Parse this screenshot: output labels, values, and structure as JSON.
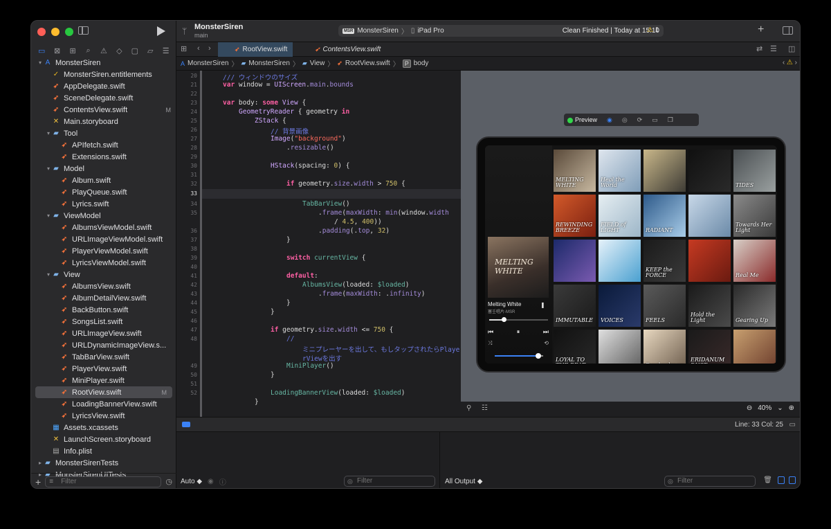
{
  "window": {
    "project_name": "MonsterSiren",
    "branch": "main"
  },
  "toolbar": {
    "scheme": "MonsterSiren",
    "device": "iPad Pro",
    "status": "Clean Finished | Today at 15:10",
    "warning_count": "1",
    "scheme_icon_text": "MSR"
  },
  "sidebar": {
    "items": [
      {
        "label": "MonsterSiren",
        "icon": "project-icon",
        "indent": 0,
        "disclosure": "open"
      },
      {
        "label": "MonsterSiren.entitlements",
        "icon": "entitlements-icon",
        "indent": 1
      },
      {
        "label": "AppDelegate.swift",
        "icon": "swift-icon",
        "indent": 1
      },
      {
        "label": "SceneDelegate.swift",
        "icon": "swift-icon",
        "indent": 1
      },
      {
        "label": "ContentsView.swift",
        "icon": "swift-icon",
        "indent": 1,
        "badge": "M"
      },
      {
        "label": "Main.storyboard",
        "icon": "storyboard-icon",
        "indent": 1
      },
      {
        "label": "Tool",
        "icon": "folder-icon",
        "indent": 1,
        "disclosure": "open"
      },
      {
        "label": "APIfetch.swift",
        "icon": "swift-icon",
        "indent": 2
      },
      {
        "label": "Extensions.swift",
        "icon": "swift-icon",
        "indent": 2
      },
      {
        "label": "Model",
        "icon": "folder-icon",
        "indent": 1,
        "disclosure": "open"
      },
      {
        "label": "Album.swift",
        "icon": "swift-icon",
        "indent": 2
      },
      {
        "label": "PlayQueue.swift",
        "icon": "swift-icon",
        "indent": 2
      },
      {
        "label": "Lyrics.swift",
        "icon": "swift-icon",
        "indent": 2
      },
      {
        "label": "ViewModel",
        "icon": "folder-icon",
        "indent": 1,
        "disclosure": "open"
      },
      {
        "label": "AlbumsViewModel.swift",
        "icon": "swift-icon",
        "indent": 2
      },
      {
        "label": "URLImageViewModel.swift",
        "icon": "swift-icon",
        "indent": 2
      },
      {
        "label": "PlayerViewModel.swift",
        "icon": "swift-icon",
        "indent": 2
      },
      {
        "label": "LyricsViewModel.swift",
        "icon": "swift-icon",
        "indent": 2
      },
      {
        "label": "View",
        "icon": "folder-icon",
        "indent": 1,
        "disclosure": "open"
      },
      {
        "label": "AlbumsView.swift",
        "icon": "swift-icon",
        "indent": 2
      },
      {
        "label": "AlbumDetailView.swift",
        "icon": "swift-icon",
        "indent": 2
      },
      {
        "label": "BackButton.swift",
        "icon": "swift-icon",
        "indent": 2
      },
      {
        "label": "SongsList.swift",
        "icon": "swift-icon",
        "indent": 2
      },
      {
        "label": "URLImageView.swift",
        "icon": "swift-icon",
        "indent": 2
      },
      {
        "label": "URLDynamicImageView.s...",
        "icon": "swift-icon",
        "indent": 2
      },
      {
        "label": "TabBarView.swift",
        "icon": "swift-icon",
        "indent": 2
      },
      {
        "label": "PlayerView.swift",
        "icon": "swift-icon",
        "indent": 2
      },
      {
        "label": "MiniPlayer.swift",
        "icon": "swift-icon",
        "indent": 2
      },
      {
        "label": "RootView.swift",
        "icon": "swift-icon",
        "indent": 2,
        "badge": "M",
        "selected": true
      },
      {
        "label": "LoadingBannerView.swift",
        "icon": "swift-icon",
        "indent": 2
      },
      {
        "label": "LyricsView.swift",
        "icon": "swift-icon",
        "indent": 2
      },
      {
        "label": "Assets.xcassets",
        "icon": "assets-icon",
        "indent": 1
      },
      {
        "label": "LaunchScreen.storyboard",
        "icon": "storyboard-icon",
        "indent": 1
      },
      {
        "label": "Info.plist",
        "icon": "plist-icon",
        "indent": 1
      },
      {
        "label": "MonsterSirenTests",
        "icon": "folder-icon",
        "indent": 0,
        "disclosure": "closed"
      },
      {
        "label": "MonsterSirenUITests",
        "icon": "folder-icon",
        "indent": 0,
        "disclosure": "closed"
      }
    ],
    "filter_placeholder": "Filter"
  },
  "tabs": [
    {
      "label": "RootView.swift",
      "active": true
    },
    {
      "label": "ContentsView.swift",
      "active": false,
      "italic": true
    }
  ],
  "jumpbar": [
    "MonsterSiren",
    "MonsterSiren",
    "View",
    "RootView.swift",
    "body"
  ],
  "jumpbar_P": "P",
  "editor": {
    "current_line": "33",
    "lines": [
      {
        "n": "20",
        "html": "<span class='cm'>/// ウィンドウのサイズ</span>",
        "indent": 2
      },
      {
        "n": "21",
        "html": "<span class='kw'>var</span> window = <span class='ty'>UIScreen</span>.<span class='pr'>main</span>.<span class='pr'>bounds</span>",
        "indent": 2
      },
      {
        "n": "22",
        "html": "",
        "indent": 0
      },
      {
        "n": "23",
        "html": "<span class='kw'>var</span> body: <span class='kw'>some</span> <span class='ty'>View</span> {",
        "indent": 2
      },
      {
        "n": "24",
        "html": "<span class='ty'>GeometryReader</span> { geometry <span class='kw'>in</span>",
        "indent": 4
      },
      {
        "n": "25",
        "html": "<span class='ty'>ZStack</span> {",
        "indent": 6
      },
      {
        "n": "26",
        "html": "<span class='cm'>// 背景画像</span>",
        "indent": 8
      },
      {
        "n": "27",
        "html": "<span class='ty'>Image</span>(<span class='st'>\"background\"</span>)",
        "indent": 8
      },
      {
        "n": "28",
        "html": ".<span class='pr'>resizable</span>()",
        "indent": 10
      },
      {
        "n": "29",
        "html": "",
        "indent": 0
      },
      {
        "n": "30",
        "html": "<span class='ty'>HStack</span>(spacing: <span class='nm'>0</span>) {",
        "indent": 8
      },
      {
        "n": "31",
        "html": "",
        "indent": 0
      },
      {
        "n": "32",
        "html": "<span class='kw'>if</span> geometry.<span class='pr'>size</span>.<span class='pr'>width</span> > <span class='nm'>750</span> {",
        "indent": 10
      },
      {
        "n": "33",
        "html": "",
        "indent": 0
      },
      {
        "n": "34",
        "html": "<span class='fn'>TabBarView</span>()",
        "indent": 12
      },
      {
        "n": "35",
        "html": ".<span class='pr'>frame</span>(<span class='pr'>maxWidth</span>: <span class='pr'>min</span>(window.<span class='pr'>width</span>",
        "indent": 14
      },
      {
        "n": "",
        "html": "/ <span class='nm'>4.5</span>, <span class='nm'>400</span>))",
        "indent": 16
      },
      {
        "n": "36",
        "html": ".<span class='pr'>padding</span>(.<span class='pr'>top</span>, <span class='nm'>32</span>)",
        "indent": 14
      },
      {
        "n": "37",
        "html": "}",
        "indent": 10
      },
      {
        "n": "38",
        "html": "",
        "indent": 0
      },
      {
        "n": "39",
        "html": "<span class='kw'>switch</span> <span class='fn'>currentView</span> {",
        "indent": 10
      },
      {
        "n": "40",
        "html": "",
        "indent": 0
      },
      {
        "n": "41",
        "html": "<span class='kw'>default</span>:",
        "indent": 10
      },
      {
        "n": "42",
        "html": "<span class='fn'>AlbumsView</span>(loaded: <span class='fn'>$loaded</span>)",
        "indent": 12
      },
      {
        "n": "43",
        "html": ".<span class='pr'>frame</span>(<span class='pr'>maxWidth</span>: .<span class='pr'>infinity</span>)",
        "indent": 14
      },
      {
        "n": "44",
        "html": "}",
        "indent": 10
      },
      {
        "n": "45",
        "html": "}",
        "indent": 8
      },
      {
        "n": "46",
        "html": "",
        "indent": 0
      },
      {
        "n": "47",
        "html": "<span class='kw'>if</span> geometry.<span class='pr'>size</span>.<span class='pr'>width</span> <= <span class='nm'>750</span> {",
        "indent": 8
      },
      {
        "n": "48",
        "html": "<span class='cm'>//</span>",
        "indent": 10
      },
      {
        "n": "",
        "html": "<span class='cm'>ミニプレーヤーを出して、もしタップされたらPlaye</span>",
        "indent": 12
      },
      {
        "n": "",
        "html": "<span class='cm'>rViewを出す</span>",
        "indent": 12
      },
      {
        "n": "49",
        "html": "<span class='fn'>MiniPlayer</span>()",
        "indent": 10
      },
      {
        "n": "50",
        "html": "}",
        "indent": 8
      },
      {
        "n": "51",
        "html": "",
        "indent": 0
      },
      {
        "n": "52",
        "html": "<span class='fn'>LoadingBannerView</span>(loaded: <span class='fn'>$loaded</span>)",
        "indent": 8
      },
      {
        "n": "",
        "html": "}",
        "indent": 6
      }
    ]
  },
  "preview": {
    "label": "Preview",
    "zoom": "40%",
    "mini_player": {
      "title": "Melting White",
      "artist": "塞壬唱片-MSR",
      "cover_text": "MELTING WHITE",
      "progress": 0.25,
      "volume": 0.9
    },
    "albums": [
      {
        "title": "MELTING WHITE",
        "color1": "#5a4a3a",
        "color2": "#c7b8a0"
      },
      {
        "title": "Heal the World",
        "color1": "#dfe6ee",
        "color2": "#7f9db8"
      },
      {
        "title": "",
        "color1": "#c9b78a",
        "color2": "#3e3c35"
      },
      {
        "title": "",
        "color1": "#101010",
        "color2": "#2a2a2a"
      },
      {
        "title": "TIDES",
        "color1": "#4a4f52",
        "color2": "#9aa0a0"
      },
      {
        "title": "REWINDING BREEZE",
        "color1": "#d35a2a",
        "color2": "#7a1f10"
      },
      {
        "title": "FIELD of LIGHT",
        "color1": "#e6eef2",
        "color2": "#9db6c8"
      },
      {
        "title": "RADIANT",
        "color1": "#2e5a8a",
        "color2": "#a8cce8"
      },
      {
        "title": "",
        "color1": "#c8d8e8",
        "color2": "#6b8aa8"
      },
      {
        "title": "Towards Her Light",
        "color1": "#8a8a8a",
        "color2": "#3a3a3a"
      },
      {
        "title": "",
        "color1": "#1c2a6a",
        "color2": "#7a5ab0"
      },
      {
        "title": "",
        "color1": "#e6f2fa",
        "color2": "#4aa0d0"
      },
      {
        "title": "KEEP the FORCE",
        "color1": "#1a1a1a",
        "color2": "#3a3a3a"
      },
      {
        "title": "",
        "color1": "#c63a22",
        "color2": "#6a1a10"
      },
      {
        "title": "Real Me",
        "color1": "#d8d0c8",
        "color2": "#8a2a2a"
      },
      {
        "title": "IMMUTABLE",
        "color1": "#3a3a3a",
        "color2": "#1a1a1a"
      },
      {
        "title": "VOICES",
        "color1": "#0a1a3a",
        "color2": "#2a3a6a"
      },
      {
        "title": "FEELS",
        "color1": "#5a5a5a",
        "color2": "#2a2a2a"
      },
      {
        "title": "Hold the Light",
        "color1": "#1a1a1a",
        "color2": "#4a4a4a"
      },
      {
        "title": "Gearing Up",
        "color1": "#2a2a2a",
        "color2": "#7a7a7a"
      },
      {
        "title": "LOYAL TO THE BEAT",
        "color1": "#111",
        "color2": "#2a2a2a"
      },
      {
        "title": "",
        "color1": "#e0e0e0",
        "color2": "#5a5a5a"
      },
      {
        "title": "Daydaydream",
        "color1": "#e8d8c0",
        "color2": "#6a5a4a"
      },
      {
        "title": "ERIDANUM DUST",
        "color1": "#1a1a1a",
        "color2": "#3a2a2a"
      },
      {
        "title": "",
        "color1": "#c8a070",
        "color2": "#6a3a2a"
      }
    ]
  },
  "debug": {
    "position": "Line: 33  Col: 25"
  },
  "console": {
    "left_mode": "Auto ◆",
    "right_mode": "All Output ◆",
    "filter_placeholder": "Filter"
  }
}
